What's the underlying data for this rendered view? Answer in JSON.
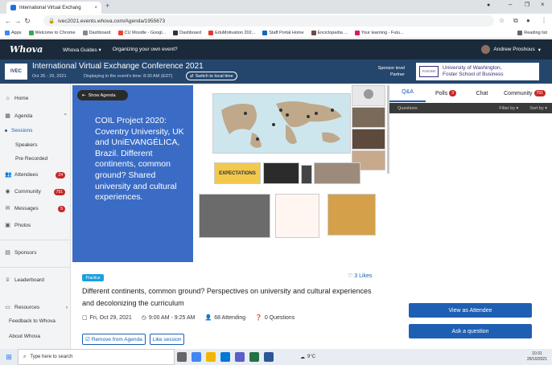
{
  "browser": {
    "tab_title": "International Virtual Exchang",
    "url": "ivec2021.events.whova.com/Agenda/1955673",
    "bookmarks": [
      "Apps",
      "Welcome to Chrome",
      "Dashboard",
      "CU Moodle - Googl...",
      "Dashboard",
      "EduMotivation 202...",
      "Staff Portal Home",
      "Enciclopedia ...",
      "Your learning - Futu..."
    ],
    "reading_list": "Reading list"
  },
  "whova": {
    "logo": "Whova",
    "guides": "Whova Guides",
    "organizing": "Organizing your own event?",
    "user": "Andrew Proshous"
  },
  "conference": {
    "logo_text": "IVEC",
    "title": "International Virtual Exchange Conference 2021",
    "dates": "Oct 26 - 29, 2021",
    "timezone": "Displaying in the event's time: 8:30 AM (EDT)",
    "switch_time": "Switch to local time",
    "sponsor_label": "Sponsor level",
    "partner": "Partner",
    "sponsor_name_1": "University of Washington,",
    "sponsor_name_2": "Foster School of Business",
    "sponsor_mini_logo": "FOSTER"
  },
  "sidebar": {
    "home": "Home",
    "agenda": "Agenda",
    "sessions": "Sessions",
    "speakers": "Speakers",
    "prerecorded": "Pre Recorded",
    "attendees": "Attendees",
    "attendees_badge": "24",
    "community": "Community",
    "community_badge": "791",
    "messages": "Messages",
    "messages_badge": "5",
    "photos": "Photos",
    "sponsors": "Sponsors",
    "leaderboard": "Leaderboard",
    "resources": "Resources",
    "feedback": "Feedback to Whova",
    "about": "About Whova"
  },
  "video": {
    "show_agenda": "Show Agenda",
    "slide_text": "COIL Project 2020: Coventry University, UK and UniEVANGÉLICA, Brazil. Different continents, common ground? Shared university and cultural experiences.",
    "sticky_note": "EXPECTATIONS"
  },
  "session": {
    "tag": "Practice",
    "likes": "3 Likes",
    "title": "Different continents, common ground? Perspectives on university and cultural experiences and decolonizing the curriculum",
    "date": "Fri, Oct 29, 2021",
    "time": "9:00 AM - 9:25 AM",
    "attending": "68 Attending",
    "questions": "0 Questions",
    "remove_agenda": "Remove from Agenda",
    "like_session": "Like session"
  },
  "right_panel": {
    "tabs": [
      "Q&A",
      "Polls",
      "Chat",
      "Community"
    ],
    "polls_badge": "3",
    "community_badge": "791",
    "questions": "Questions",
    "filter": "Filter by",
    "sort": "Sort by",
    "view_attendee": "View as Attendee",
    "ask_question": "Ask a question"
  },
  "taskbar": {
    "search": "Type here to search",
    "temp": "9°C",
    "time": "10:31",
    "date": "29/10/2021"
  },
  "colors": {
    "whova_bar": "#1b2a3a",
    "conf_bar": "#25466c",
    "slide_blue": "#3a6cc6",
    "accent_blue": "#1f5fb3",
    "badge_red": "#c62828"
  }
}
